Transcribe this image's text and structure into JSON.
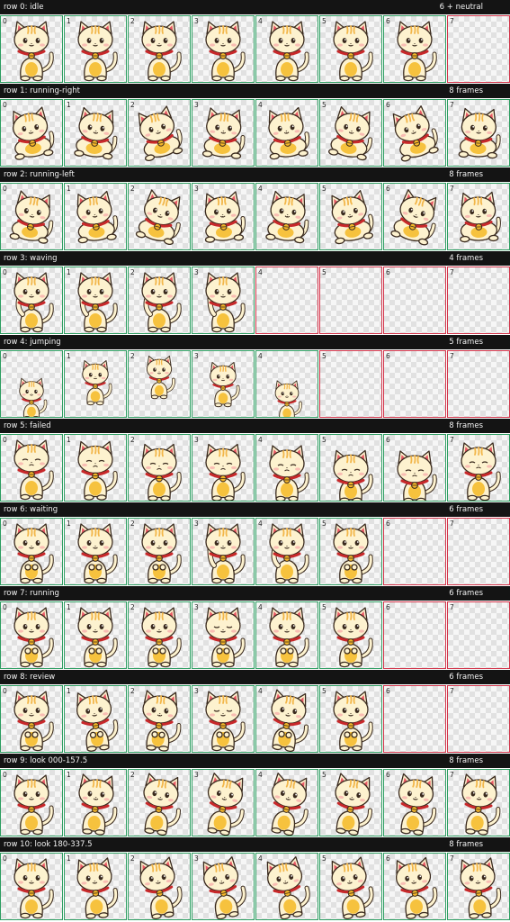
{
  "palette": {
    "header_bg": "#141414",
    "header_text": "#f2f2f2",
    "filled_border": "#2e9e62",
    "empty_border": "#d2344a",
    "checker_light": "#f6f6f6",
    "checker_dark": "#e1e1e1",
    "cat_body": "#fdf2cf",
    "cat_outline": "#3a2a1e",
    "cat_stripe": "#f2b64a",
    "cat_belly": "#f6c23e",
    "collar": "#c8282a",
    "bell": "#f4b629",
    "inner_ear": "#e85a66"
  },
  "rows": [
    {
      "title": "row 0: idle",
      "count": "6 + neutral",
      "frames": 7,
      "pose": "idle",
      "cells": [
        "0",
        "1",
        "2",
        "3",
        "4",
        "5",
        "6",
        "7"
      ]
    },
    {
      "title": "row 1: running-right",
      "count": "8 frames",
      "frames": 8,
      "pose": "run-right",
      "cells": [
        "0",
        "1",
        "2",
        "3",
        "4",
        "5",
        "6",
        "7"
      ]
    },
    {
      "title": "row 2: running-left",
      "count": "8 frames",
      "frames": 8,
      "pose": "run-left",
      "cells": [
        "0",
        "1",
        "2",
        "3",
        "4",
        "5",
        "6",
        "7"
      ]
    },
    {
      "title": "row 3: waving",
      "count": "4 frames",
      "frames": 4,
      "pose": "wave",
      "cells": [
        "0",
        "1",
        "2",
        "3",
        "4",
        "5",
        "6",
        "7"
      ]
    },
    {
      "title": "row 4: jumping",
      "count": "5 frames",
      "frames": 5,
      "pose": "jump",
      "cells": [
        "0",
        "1",
        "2",
        "3",
        "4",
        "5",
        "6",
        "7"
      ]
    },
    {
      "title": "row 5: failed",
      "count": "8 frames",
      "frames": 8,
      "pose": "failed",
      "cells": [
        "0",
        "1",
        "2",
        "3",
        "4",
        "5",
        "6",
        "7"
      ]
    },
    {
      "title": "row 6: waiting",
      "count": "6 frames",
      "frames": 6,
      "pose": "waiting",
      "cells": [
        "0",
        "1",
        "2",
        "3",
        "4",
        "5",
        "6",
        "7"
      ]
    },
    {
      "title": "row 7: running",
      "count": "6 frames",
      "frames": 6,
      "pose": "running",
      "cells": [
        "0",
        "1",
        "2",
        "3",
        "4",
        "5",
        "6",
        "7"
      ]
    },
    {
      "title": "row 8: review",
      "count": "6 frames",
      "frames": 6,
      "pose": "review",
      "cells": [
        "0",
        "1",
        "2",
        "3",
        "4",
        "5",
        "6",
        "7"
      ]
    },
    {
      "title": "row 9: look 000-157.5",
      "count": "8 frames",
      "frames": 8,
      "pose": "look-a",
      "cells": [
        "0",
        "1",
        "2",
        "3",
        "4",
        "5",
        "6",
        "7"
      ]
    },
    {
      "title": "row 10: look 180-337.5",
      "count": "8 frames",
      "frames": 8,
      "pose": "look-b",
      "cells": [
        "0",
        "1",
        "2",
        "3",
        "4",
        "5",
        "6",
        "7"
      ]
    }
  ]
}
